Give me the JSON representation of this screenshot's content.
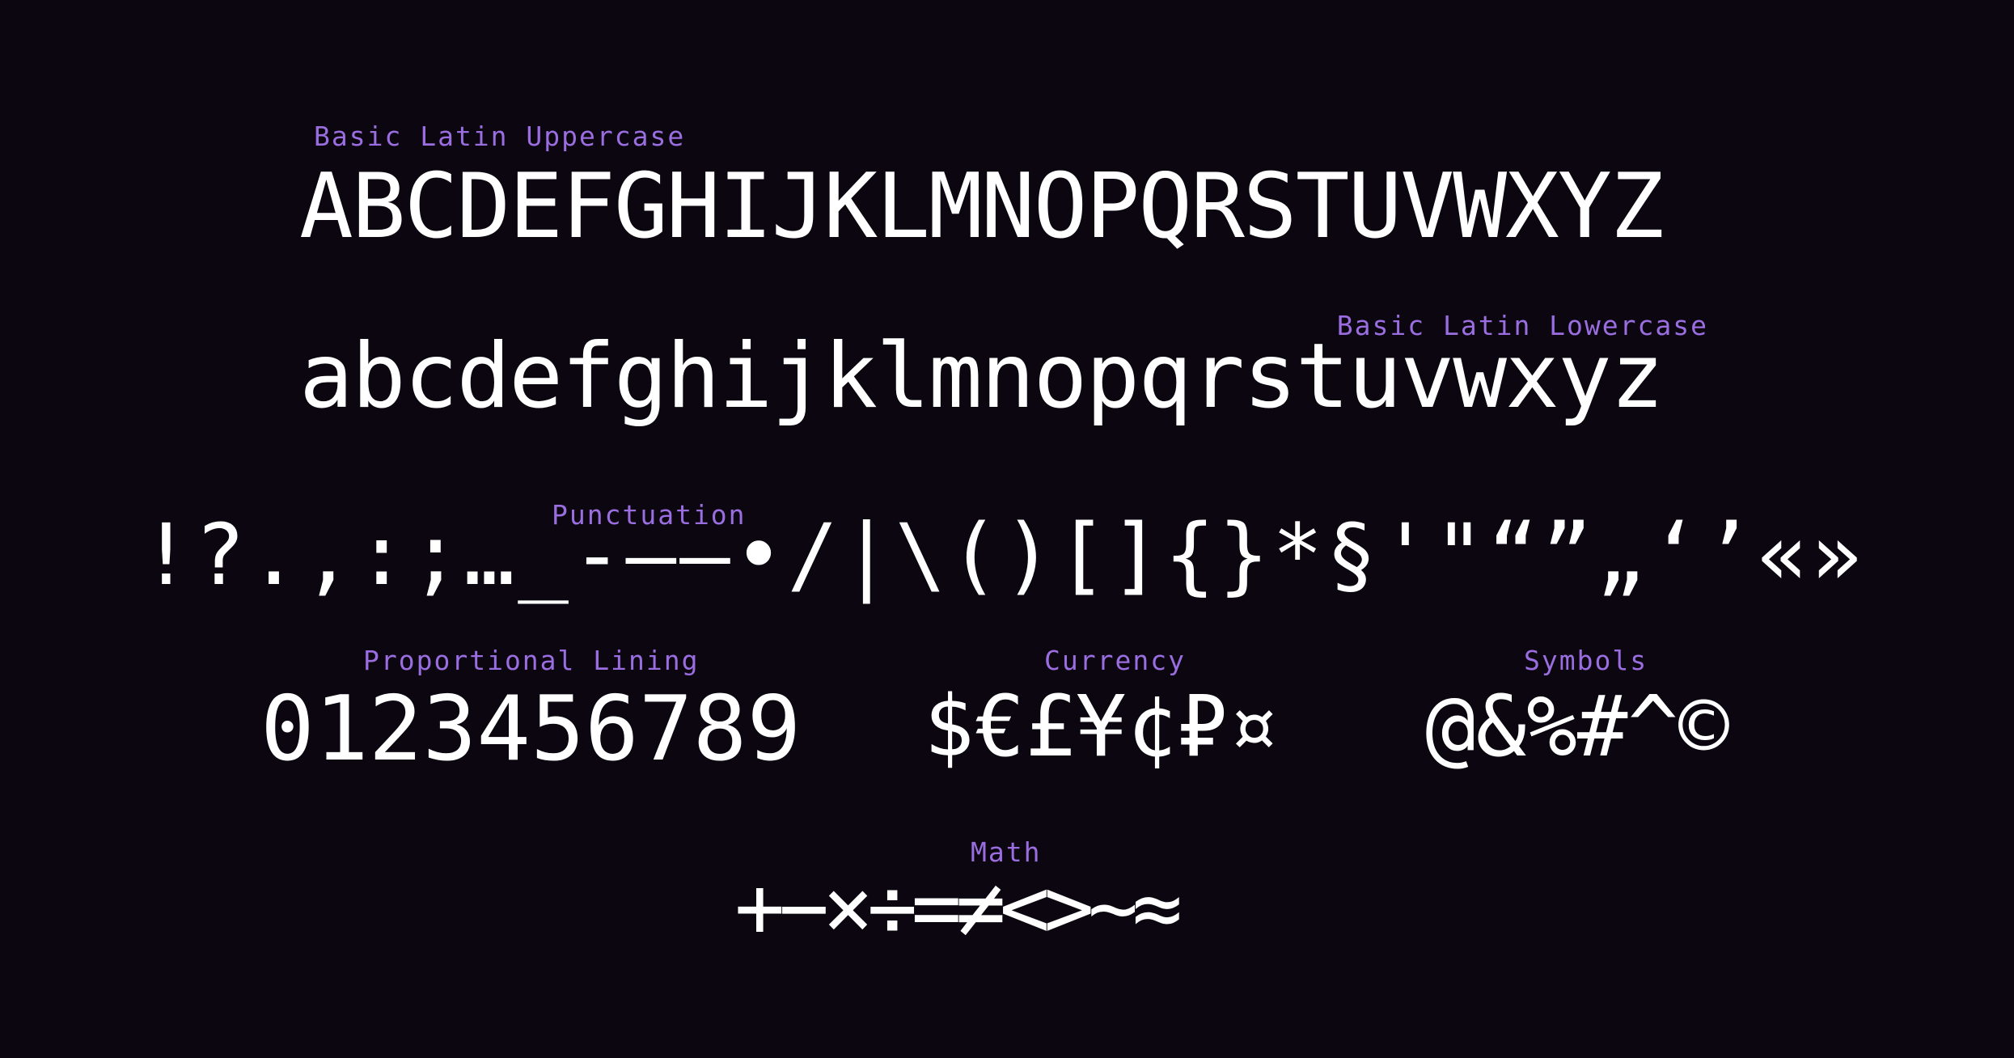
{
  "specimen": {
    "sections": [
      {
        "label": "Basic Latin Uppercase",
        "glyphs": "ABCDEFGHIJKLMNOPQRSTUVWXYZ"
      },
      {
        "label": "Basic Latin Lowercase",
        "glyphs": "abcdefghijklmnopqrstuvwxyz"
      },
      {
        "label": "Punctuation",
        "glyphs": "!?.,:;…_‐–—•/|\\()[]{}*§'\"“”„‘’«»"
      },
      {
        "label": "Proportional Lining",
        "glyphs": "0123456789"
      },
      {
        "label": "Currency",
        "glyphs": "$€£¥¢₽¤"
      },
      {
        "label": "Symbols",
        "glyphs": "@&%#^©"
      },
      {
        "label": "Math",
        "glyphs": "+−×÷=≠<>~≈"
      }
    ]
  },
  "colors": {
    "background": "#0b060f",
    "label": "#9a6ee0",
    "glyph": "#ffffff"
  }
}
